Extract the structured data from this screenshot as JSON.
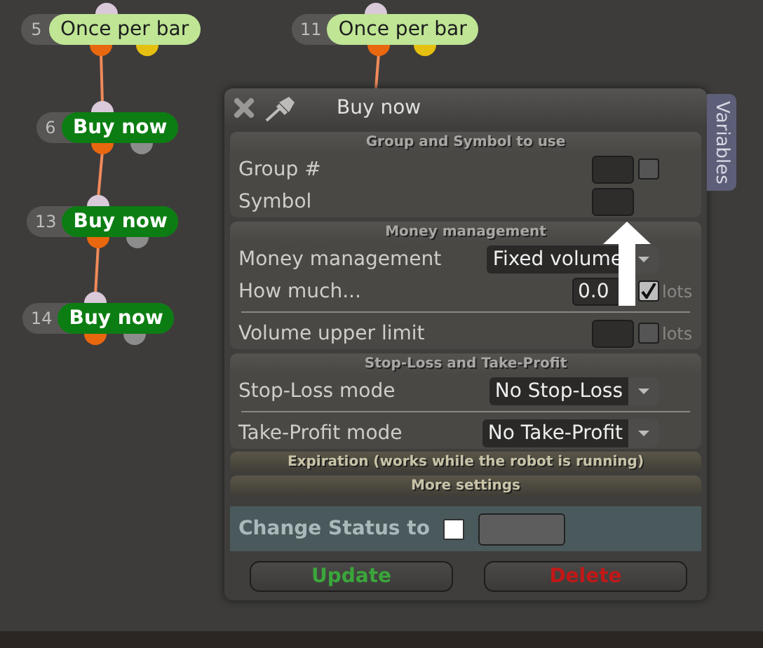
{
  "canvas": {
    "nodes": [
      {
        "number": "5",
        "label": "Once per bar",
        "kind": "trigger"
      },
      {
        "number": "11",
        "label": "Once per bar",
        "kind": "trigger"
      },
      {
        "number": "6",
        "label": "Buy now",
        "kind": "action"
      },
      {
        "number": "13",
        "label": "Buy now",
        "kind": "action"
      },
      {
        "number": "14",
        "label": "Buy now",
        "kind": "action"
      }
    ]
  },
  "dialog": {
    "title": "Buy now",
    "side_tab": "Variables",
    "sections": [
      {
        "title": "Group and Symbol to use",
        "rows": [
          {
            "kind": "field",
            "label": "Group #",
            "checked": false
          },
          {
            "kind": "plainfield",
            "label": "Symbol"
          }
        ]
      },
      {
        "title": "Money management",
        "rows": [
          {
            "kind": "select",
            "label": "Money management",
            "value": "Fixed volume"
          },
          {
            "kind": "field",
            "label": "How much...",
            "value": "0.0",
            "checked": true,
            "unit": "lots"
          },
          {
            "kind": "divider"
          },
          {
            "kind": "field",
            "label": "Volume upper limit",
            "checked": false,
            "unit": "lots"
          }
        ]
      },
      {
        "title": "Stop-Loss and Take-Profit",
        "rows": [
          {
            "kind": "select",
            "label": "Stop-Loss mode",
            "value": "No Stop-Loss"
          },
          {
            "kind": "divider"
          },
          {
            "kind": "select",
            "label": "Take-Profit mode",
            "value": "No Take-Profit"
          }
        ]
      }
    ],
    "collapsed_sections": [
      "Expiration (works while the robot is running)",
      "More settings"
    ],
    "status": {
      "label": "Change Status to",
      "checked": false
    },
    "buttons": [
      {
        "label": "Update",
        "kind": "confirm"
      },
      {
        "label": "Delete",
        "kind": "danger"
      }
    ]
  }
}
